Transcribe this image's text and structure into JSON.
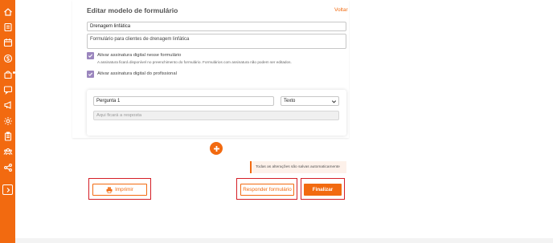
{
  "sidebar": {
    "items": [
      {
        "icon": "home-icon"
      },
      {
        "icon": "clients-icon"
      },
      {
        "icon": "calendar-icon"
      },
      {
        "icon": "money-icon"
      },
      {
        "icon": "products-bag-icon"
      },
      {
        "icon": "chat-icon"
      },
      {
        "icon": "megaphone-icon"
      },
      {
        "icon": "gear-icon"
      },
      {
        "icon": "clipboard-icon"
      },
      {
        "icon": "team-icon"
      },
      {
        "icon": "share-icon"
      }
    ],
    "expand_icon": "chevron-right-icon"
  },
  "header": {
    "title": "Editar modelo de formulário",
    "back_label": "Voltar"
  },
  "form": {
    "name_value": "Drenagem linfática",
    "description_value": "Formulário para clientes de drenagem linfática",
    "client_signature": {
      "checked": true,
      "label": "Ativar assinatura digital nesse formulário",
      "hint": "A assinatura ficará disponível no preenchimento do formulário. Formulários com assinatura não podem ser editados."
    },
    "professional_signature": {
      "checked": true,
      "label": "Ativar assinatura digital do profissional"
    }
  },
  "question": {
    "title_value": "Pergunta 1",
    "type_value": "Texto",
    "answer_placeholder": "Aqui ficará a resposta"
  },
  "add_question_icon": "plus-icon",
  "toast": {
    "text": "Todas as alterações são salvas automaticamente"
  },
  "actions": {
    "print_label": "Imprimir",
    "respond_label": "Responder formulário",
    "finish_label": "Finalizar"
  },
  "colors": {
    "accent": "#f26a10",
    "checkbox": "#9b86be",
    "highlight": "#d41e26"
  }
}
